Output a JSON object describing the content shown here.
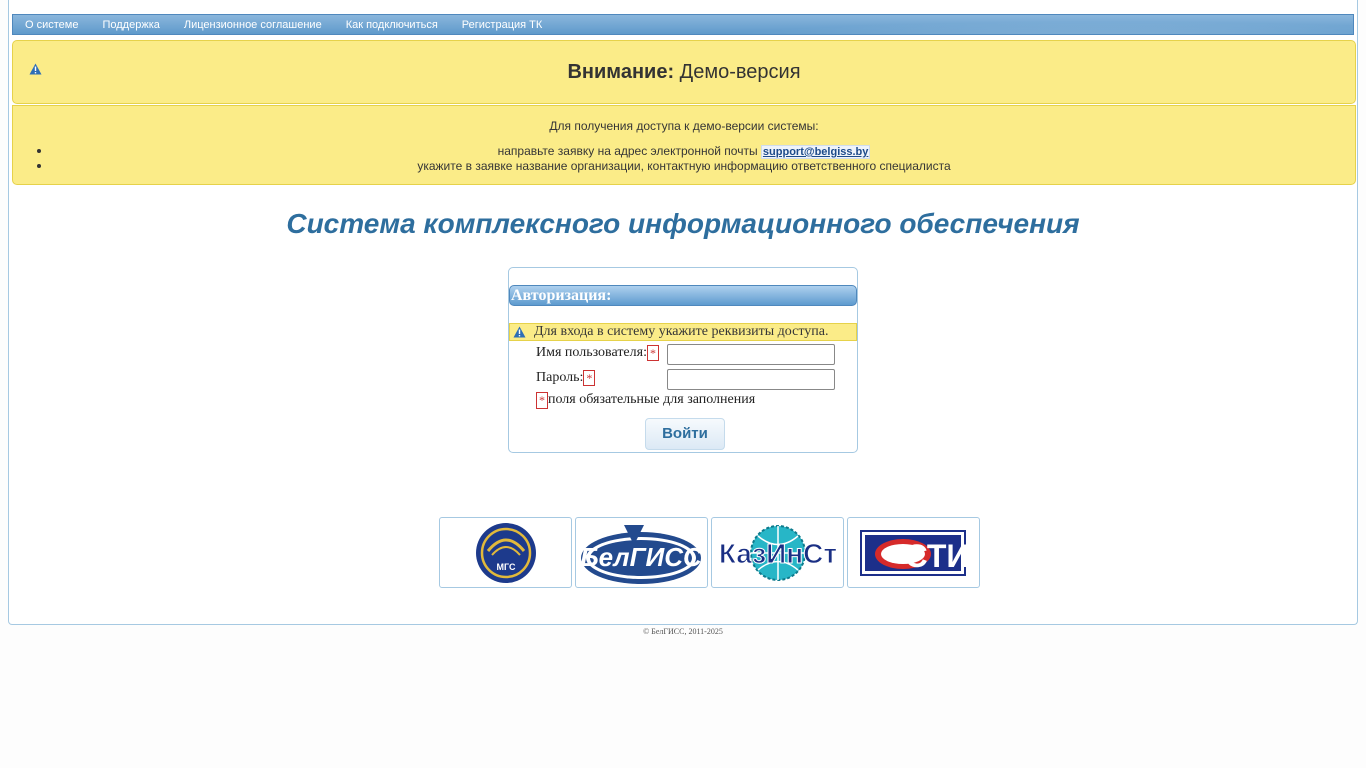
{
  "nav": {
    "items": [
      {
        "label": "О системе"
      },
      {
        "label": "Поддержка"
      },
      {
        "label": "Лицензионное соглашение"
      },
      {
        "label": "Как подключиться"
      },
      {
        "label": "Регистрация ТК"
      }
    ]
  },
  "warning": {
    "title_bold": "Внимание:",
    "title_text": "Демо-версия",
    "icon": "warning-icon"
  },
  "info": {
    "heading": "Для получения доступа к демо-версии системы:",
    "item1_text": "направьте заявку на адрес электронной почты",
    "email": "support@belgiss.by",
    "item2_text": "укажите в заявке название организации, контактную информацию ответственного специалиста"
  },
  "system_title": "Система комплексного информационного обеспечения",
  "auth": {
    "header": "Авторизация:",
    "notice": "Для входа в систему укажите реквизиты доступа.",
    "username_label": "Имя пользователя:",
    "password_label": "Пароль:",
    "required_mark": "*",
    "required_note": "поля обязательные для заполнения",
    "login_button": "Войти",
    "username_value": "",
    "password_value": ""
  },
  "logos": [
    {
      "name": "МГС",
      "icon": "mgs-logo"
    },
    {
      "name": "БелГИСС",
      "icon": "belgiss-logo"
    },
    {
      "name": "КазИнСт",
      "icon": "kazinst-logo"
    },
    {
      "name": "СТИ",
      "icon": "sti-logo"
    }
  ],
  "footer": "© БелГИСС, 2011-2025",
  "colors": {
    "accent": "#2e6e9e",
    "warning_bg": "#fbec88",
    "nav_bg": "#5f9acb",
    "border": "#a6c9e2"
  }
}
